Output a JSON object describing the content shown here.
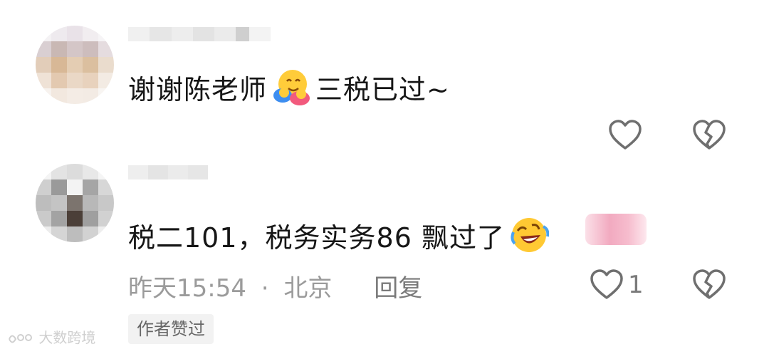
{
  "comments": [
    {
      "text_before": "谢谢陈老师",
      "emoji": "hugging-face-emoji",
      "text_after": " 三税已过~"
    },
    {
      "text_before": "税二101，税务实务86 飘过了",
      "emoji": "rolling-on-floor-laughing-emoji",
      "meta": {
        "time": "昨天15:54",
        "separator": "·",
        "location": "北京",
        "reply_label": "回复"
      },
      "like_count": "1",
      "author_badge": "作者赞过"
    }
  ],
  "watermark": "大数跨境",
  "colors": {
    "text": "#161616",
    "meta": "#9b9b9b",
    "icon": "#6f6f6f"
  }
}
